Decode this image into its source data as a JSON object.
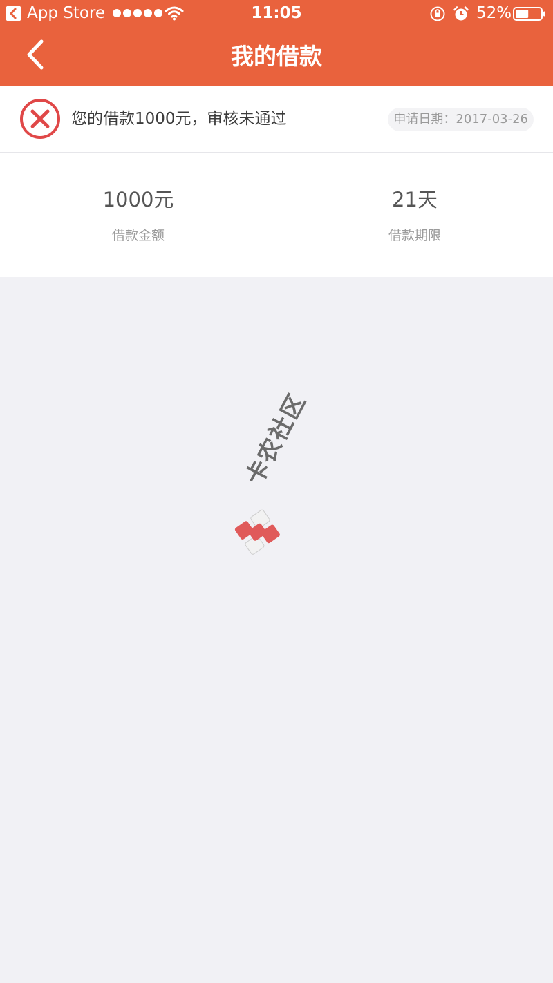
{
  "status_bar": {
    "carrier": "App Store",
    "time": "11:05",
    "battery_percent": "52%",
    "battery_level": 0.52
  },
  "header": {
    "title": "我的借款",
    "background_color": "#e9623d"
  },
  "loan_status": {
    "message": "您的借款1000元，审核未通过",
    "date": "申请日期：2017-03-26",
    "status_color": "#e04848"
  },
  "summary": {
    "amount_value": "1000元",
    "amount_label": "借款金额",
    "term_value": "21天",
    "term_label": "借款期限"
  },
  "watermark": {
    "text": "卡农社区"
  }
}
